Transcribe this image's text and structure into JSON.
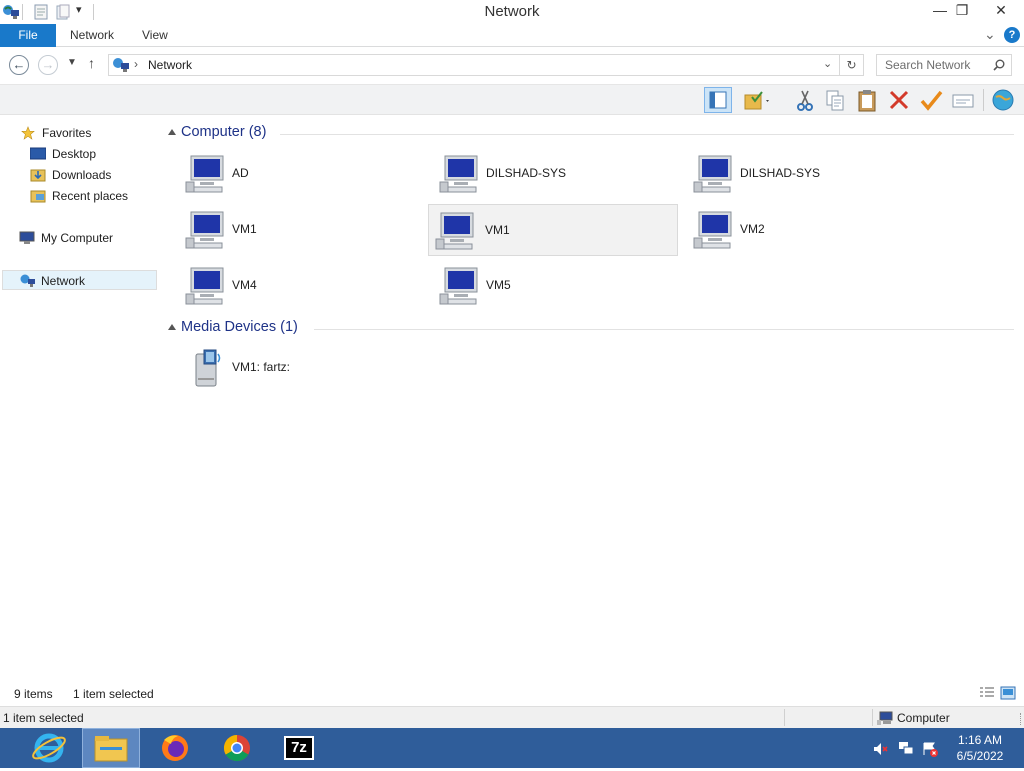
{
  "window": {
    "title": "Network",
    "minimize": "—",
    "restore": "❐",
    "close": "✕"
  },
  "ribbon": {
    "tabs": [
      "File",
      "Network",
      "View"
    ],
    "expand_glyph": "⌄",
    "help_glyph": "?"
  },
  "address": {
    "path": "Network",
    "separator": "›",
    "search_placeholder": "Search Network"
  },
  "sidebar": {
    "favorites": "Favorites",
    "items": [
      "Desktop",
      "Downloads",
      "Recent places"
    ],
    "my_computer": "My Computer",
    "network": "Network"
  },
  "groups": [
    {
      "title": "Computer (8)",
      "items": [
        "AD",
        "DILSHAD-SYS",
        "DILSHAD-SYS",
        "VM1",
        "VM1",
        "VM2",
        "VM4",
        "VM5"
      ]
    },
    {
      "title": "Media Devices (1)",
      "items": [
        "VM1: fartz:"
      ]
    }
  ],
  "selected_item": "VM1",
  "status": {
    "items_count": "9 items",
    "selected_count": "1 item selected",
    "bottom_left": "1 item selected",
    "bottom_right": "Computer"
  },
  "taskbar": {
    "apps": [
      "internet-explorer",
      "file-explorer",
      "firefox",
      "chrome",
      "7-zip"
    ],
    "sevenzip_label": "7z",
    "time": "1:16 AM",
    "date": "6/5/2022"
  },
  "colors": {
    "file_tab": "#1979ca",
    "taskbar": "#2f5d9a",
    "group_title": "#1e3287"
  }
}
